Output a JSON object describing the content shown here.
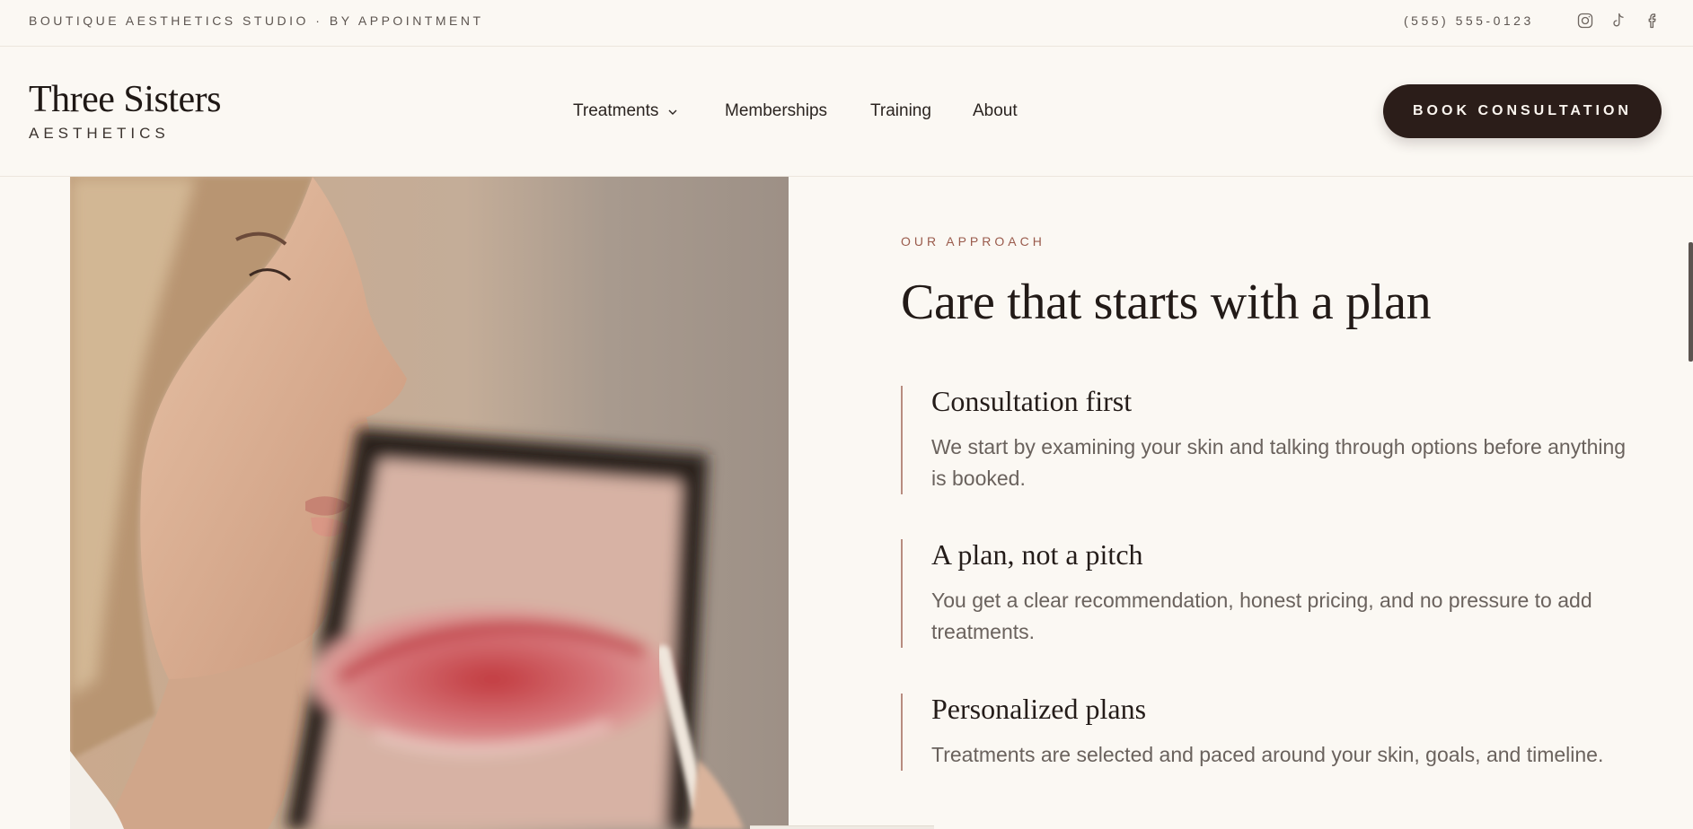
{
  "topbar": {
    "tagline": "BOUTIQUE AESTHETICS STUDIO · BY APPOINTMENT",
    "phone": "(555) 555-0123",
    "social_icons": [
      "instagram-icon",
      "tiktok-icon",
      "facebook-icon"
    ]
  },
  "header": {
    "logo_name": "Three Sisters",
    "logo_sub": "AESTHETICS",
    "nav": [
      {
        "label": "Treatments",
        "has_dropdown": true
      },
      {
        "label": "Memberships"
      },
      {
        "label": "Training"
      },
      {
        "label": "About"
      }
    ],
    "cta_label": "BOOK CONSULTATION"
  },
  "approach": {
    "eyebrow": "OUR APPROACH",
    "heading": "Care that starts with a plan",
    "features": [
      {
        "title": "Consultation first",
        "body": "We start by examining your skin and talking through options before anything is booked."
      },
      {
        "title": "A plan, not a pitch",
        "body": "You get a clear recommendation, honest pricing, and no pressure to add treatments."
      },
      {
        "title": "Personalized plans",
        "body": "Treatments are selected and paced around your skin, goals, and timeline."
      }
    ]
  },
  "colors": {
    "background": "#fbf8f3",
    "cta_background": "#2b1d19",
    "accent": "#9a5b4c",
    "feature_rule": "#b88c80"
  }
}
